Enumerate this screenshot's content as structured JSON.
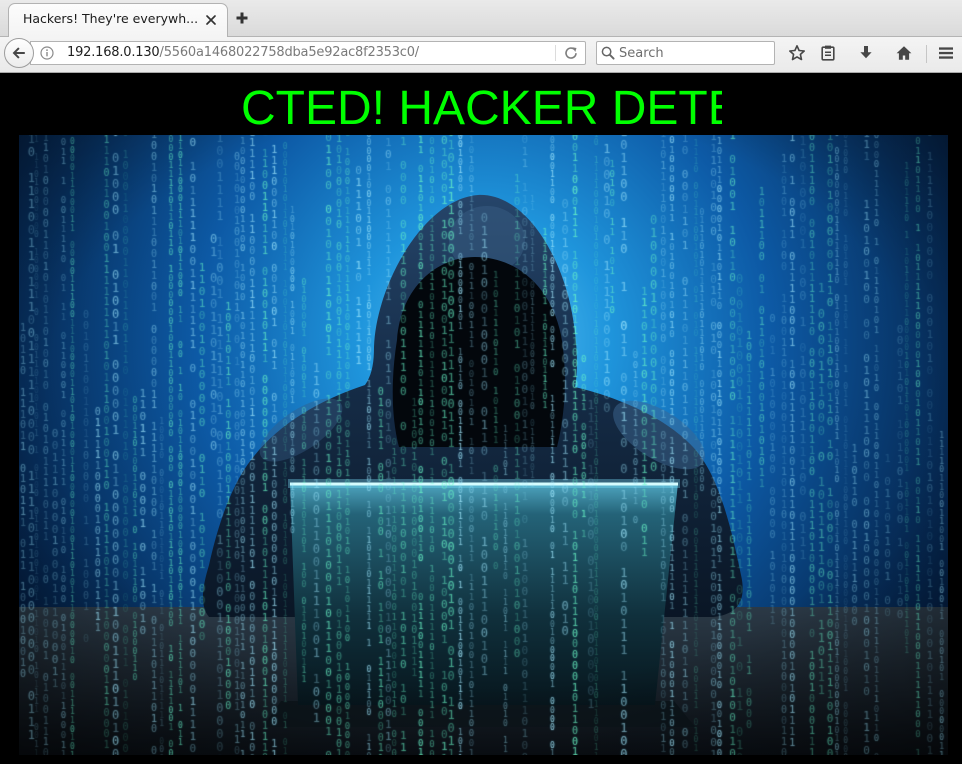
{
  "window": {
    "tabs": [
      {
        "title": "Hackers! They're everywh...",
        "active": true,
        "close_icon": "close-icon"
      }
    ],
    "new_tab_icon": "plus-icon"
  },
  "toolbar": {
    "back_icon": "back-arrow-icon",
    "identity_icon": "info-icon",
    "url": {
      "host": "192.168.0.130",
      "path": "/5560a1468022758dba5e92ac8f2353c0/"
    },
    "reload_icon": "reload-icon",
    "search": {
      "placeholder": "Search",
      "icon": "search-icon"
    },
    "buttons": [
      {
        "icon": "star-icon"
      },
      {
        "icon": "clipboard-icon"
      },
      {
        "icon": "download-icon"
      },
      {
        "icon": "home-icon"
      },
      {
        "icon": "hamburger-menu-icon"
      }
    ]
  },
  "page": {
    "marquee_text": "CTED! HACKER DETE",
    "text_color": "#00ff00",
    "background_color": "#000000"
  }
}
